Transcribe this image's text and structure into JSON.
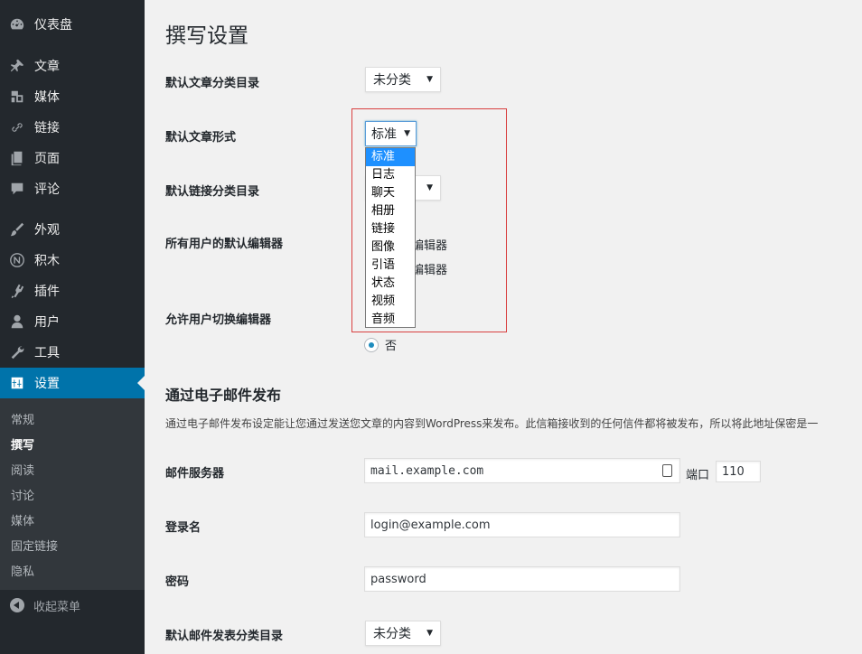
{
  "sidebar": {
    "items": [
      {
        "label": "仪表盘",
        "icon": "dashboard-icon"
      },
      {
        "label": "文章",
        "icon": "pin-icon"
      },
      {
        "label": "媒体",
        "icon": "media-icon"
      },
      {
        "label": "链接",
        "icon": "link-icon"
      },
      {
        "label": "页面",
        "icon": "page-icon"
      },
      {
        "label": "评论",
        "icon": "comment-icon"
      },
      {
        "label": "外观",
        "icon": "brush-icon"
      },
      {
        "label": "积木",
        "icon": "blocks-icon"
      },
      {
        "label": "插件",
        "icon": "plugin-icon"
      },
      {
        "label": "用户",
        "icon": "user-icon"
      },
      {
        "label": "工具",
        "icon": "wrench-icon"
      },
      {
        "label": "设置",
        "icon": "settings-icon"
      }
    ],
    "submenu": [
      "常规",
      "撰写",
      "阅读",
      "讨论",
      "媒体",
      "固定链接",
      "隐私"
    ],
    "collapse_label": "收起菜单"
  },
  "main": {
    "title": "撰写设置",
    "default_category_label": "默认文章分类目录",
    "default_category_value": "未分类",
    "default_format_label": "默认文章形式",
    "default_format_value": "标准",
    "default_link_category_label": "默认链接分类目录",
    "default_editor_label": "所有用户的默认编辑器",
    "editor_option_1_partial": "编辑器",
    "editor_option_2_partial": "编辑器",
    "allow_switch_label": "允许用户切换编辑器",
    "allow_switch_no": "否",
    "format_options": [
      "标准",
      "日志",
      "聊天",
      "相册",
      "链接",
      "图像",
      "引语",
      "状态",
      "视频",
      "音频"
    ],
    "email_section_title": "通过电子邮件发布",
    "email_section_desc": "通过电子邮件发布设定能让您通过发送您文章的内容到WordPress来发布。此信箱接收到的任何信件都将被发布，所以将此地址保密是一",
    "mail_server_label": "邮件服务器",
    "mail_server_value": "mail.example.com",
    "port_label": "端口",
    "port_value": "110",
    "login_label": "登录名",
    "login_value": "login@example.com",
    "password_label": "密码",
    "password_value": "password",
    "mail_category_label": "默认邮件发表分类目录",
    "mail_category_value": "未分类"
  }
}
